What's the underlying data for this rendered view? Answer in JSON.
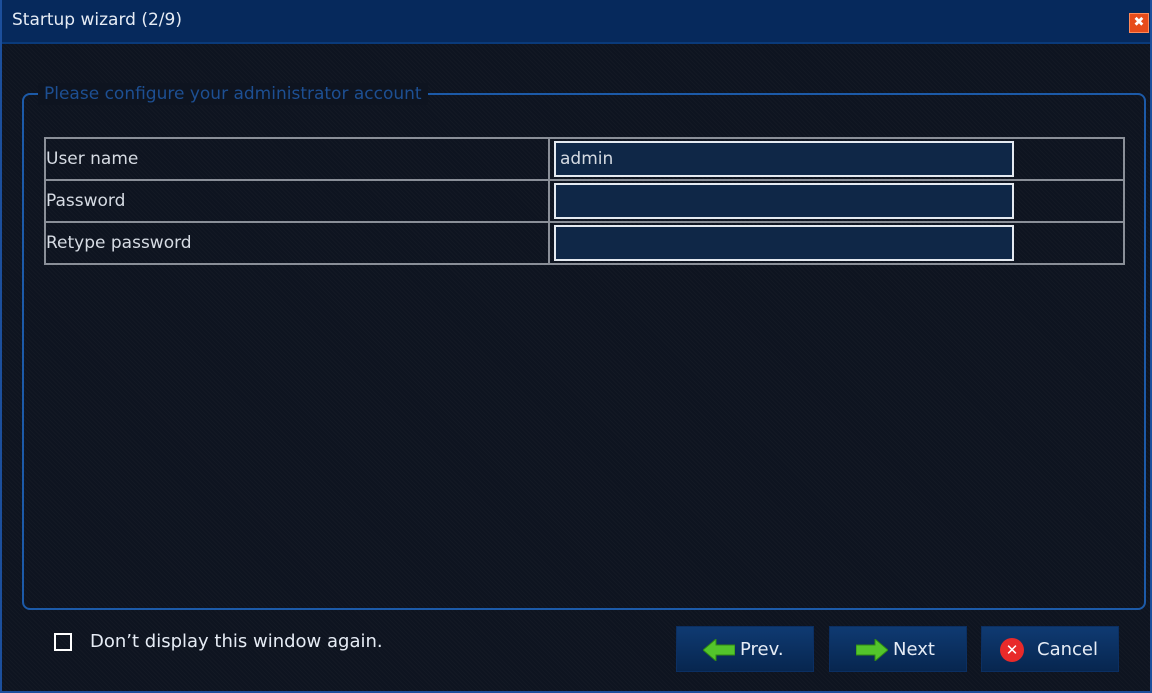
{
  "window": {
    "title": "Startup wizard (2/9)",
    "close_glyph": "✖"
  },
  "group": {
    "legend": "Please configure your administrator account"
  },
  "form": {
    "rows": [
      {
        "label": "User name",
        "value": "admin"
      },
      {
        "label": "Password",
        "value": ""
      },
      {
        "label": "Retype password",
        "value": ""
      }
    ]
  },
  "footer": {
    "checkbox_label": "Don’t display this window again.",
    "checkbox_checked": false,
    "prev_label": "Prev.",
    "next_label": "Next",
    "cancel_label": "Cancel",
    "cancel_glyph": "✕"
  },
  "icons": {
    "close": "close-icon",
    "prev": "arrow-left-icon",
    "next": "arrow-right-icon",
    "cancel": "cancel-icon"
  },
  "colors": {
    "titlebar": "#06295c",
    "background": "#0e1420",
    "accent": "#1c5aa8",
    "arrow_green": "#53c52b",
    "cancel_red": "#e82a2a"
  }
}
